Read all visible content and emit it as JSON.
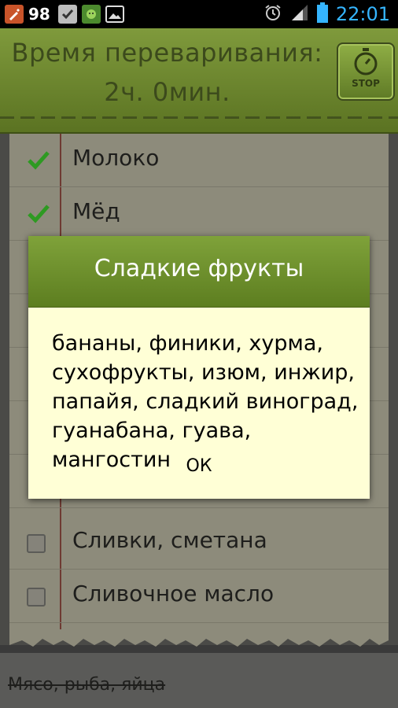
{
  "statusbar": {
    "battery_percent_left": "98",
    "time": "22:01",
    "icons": [
      "pencil-app-icon",
      "checkbox-icon",
      "android-icon",
      "image-icon",
      "alarm-icon",
      "signal-icon",
      "battery-icon"
    ]
  },
  "header": {
    "title_line1": "Время переваривания:",
    "title_line2": "2ч. 0мин.",
    "stop_label": "STOP"
  },
  "list": {
    "items": [
      {
        "label": "Молоко",
        "checked": true
      },
      {
        "label": "Мёд",
        "checked": true
      },
      {
        "label": "Сливки, сметана",
        "checked": false
      },
      {
        "label": "Сливочное масло",
        "checked": false
      }
    ]
  },
  "footer": {
    "category": "Мясо, рыба, яйца"
  },
  "dialog": {
    "title": "Сладкие фрукты",
    "body": "бананы, финики, хурма, сухофрукты, изюм, инжир, папайя, сладкий виноград, гуанабана, гуава, мангостин",
    "ok_label": "ОК"
  },
  "colors": {
    "header_green": "#6f8a30",
    "check_green": "#2e9a22",
    "time_blue": "#35b5ff",
    "dialog_bg": "#ffffd6"
  }
}
